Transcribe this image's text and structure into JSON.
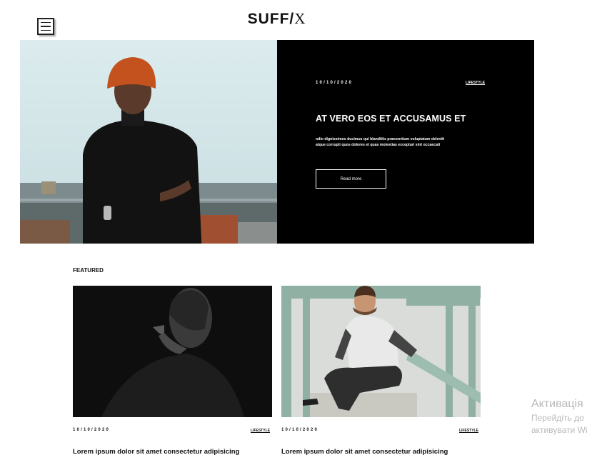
{
  "header": {
    "logo_part1": "SUFF",
    "logo_slash": "/",
    "logo_part2": "X"
  },
  "hero": {
    "date": "10/10/2020",
    "category": "LIFESTYLE",
    "title": "AT VERO EOS ET ACCUSAMUS ET",
    "excerpt_line1": "odio dignissimos ducimus qui blanditiis praesentium voluptatum deleniti",
    "excerpt_line2": "atque corrupti quos dolores et quas molestias excepturi sint occaecati",
    "read_more": "Read more"
  },
  "featured": {
    "heading": "FEATURED",
    "cards": [
      {
        "date": "10/10/2020",
        "category": "LIFESTYLE",
        "title": "Lorem ipsum dolor sit amet consectetur adipisicing"
      },
      {
        "date": "10/10/2020",
        "category": "LIFESTYLE",
        "title": "Lorem ipsum dolor sit amet consectetur adipisicing"
      }
    ]
  },
  "watermark": {
    "line1": "Активація",
    "line2": "Перейдіть до",
    "line3": "активувати Wi"
  },
  "colors": {
    "hero_panel_bg": "#000000",
    "text": "#111111",
    "watermark": "#b9b9b9"
  }
}
